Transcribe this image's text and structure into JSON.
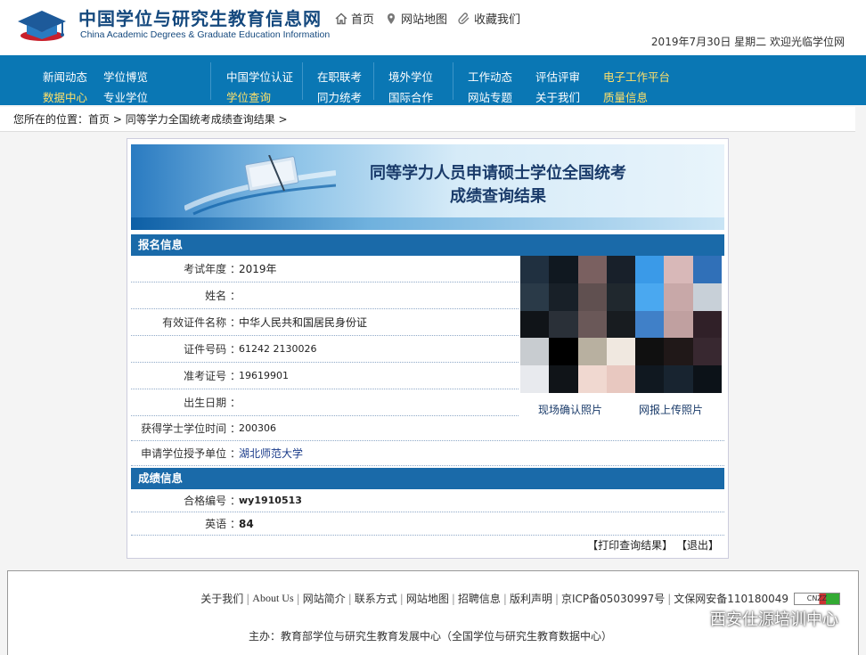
{
  "header": {
    "title": "中国学位与研究生教育信息网",
    "subtitle": "China Academic Degrees & Graduate Education Information",
    "links": [
      "首页",
      "网站地图",
      "收藏我们"
    ],
    "date_line": "2019年7月30日  星期二   欢迎光临学位网"
  },
  "nav": {
    "col1": [
      "新闻动态",
      "学位博览",
      "数据中心",
      "专业学位"
    ],
    "col2": [
      "中国学位认证",
      "学位查询"
    ],
    "col3": [
      "在职联考",
      "同力统考"
    ],
    "col4": [
      "境外学位",
      "国际合作"
    ],
    "col5": [
      "工作动态",
      "评估评审",
      "电子工作平台",
      "网站专题",
      "关于我们",
      "质量信息"
    ]
  },
  "breadcrumb": {
    "prefix": "您所在的位置：",
    "home": "首页",
    "sep": " > ",
    "current": "同等学力全国统考成绩查询结果",
    "end": " >"
  },
  "banner": {
    "line1": "同等学力人员申请硕士学位全国统考",
    "line2": "成绩查询结果"
  },
  "registration": {
    "title": "报名信息",
    "fields": [
      {
        "label": "考试年度 ：",
        "value": "2019年"
      },
      {
        "label": "姓名 ：",
        "value": ""
      },
      {
        "label": "有效证件名称 ：",
        "value": "中华人民共和国居民身份证"
      },
      {
        "label": "证件号码 ：",
        "value": "61242        2130026"
      },
      {
        "label": "准考证号 ：",
        "value": "19619901"
      },
      {
        "label": "出生日期 ：",
        "value": ""
      },
      {
        "label": "获得学士学位时间 ：",
        "value": "200306"
      },
      {
        "label": "申请学位授予单位 ：",
        "value": "湖北师范大学"
      }
    ],
    "photo_captions": [
      "现场确认照片",
      "网报上传照片"
    ]
  },
  "scores": {
    "title": "成绩信息",
    "fields": [
      {
        "label": "合格编号 ：",
        "value": "wy1910513"
      },
      {
        "label": "英语 ：",
        "value": "84"
      }
    ]
  },
  "actions": {
    "print": "【打印查询结果】",
    "exit": "【退出】"
  },
  "footer": {
    "links": [
      "关于我们",
      "About Us",
      "网站简介",
      "联系方式",
      "网站地图",
      "招聘信息",
      "版利声明",
      "京ICP备05030997号",
      "文保网安备110180049"
    ],
    "badge": "CNZZ",
    "host": "主办：教育部学位与研究生教育发展中心（全国学位与研究生教育数据中心）",
    "watermark": "西安仕源培训中心"
  },
  "colors": {
    "brand_blue": "#15497e",
    "nav_blue": "#0a77b4",
    "section_blue": "#1a6aa9",
    "nav_highlight": "#ffe06a"
  }
}
